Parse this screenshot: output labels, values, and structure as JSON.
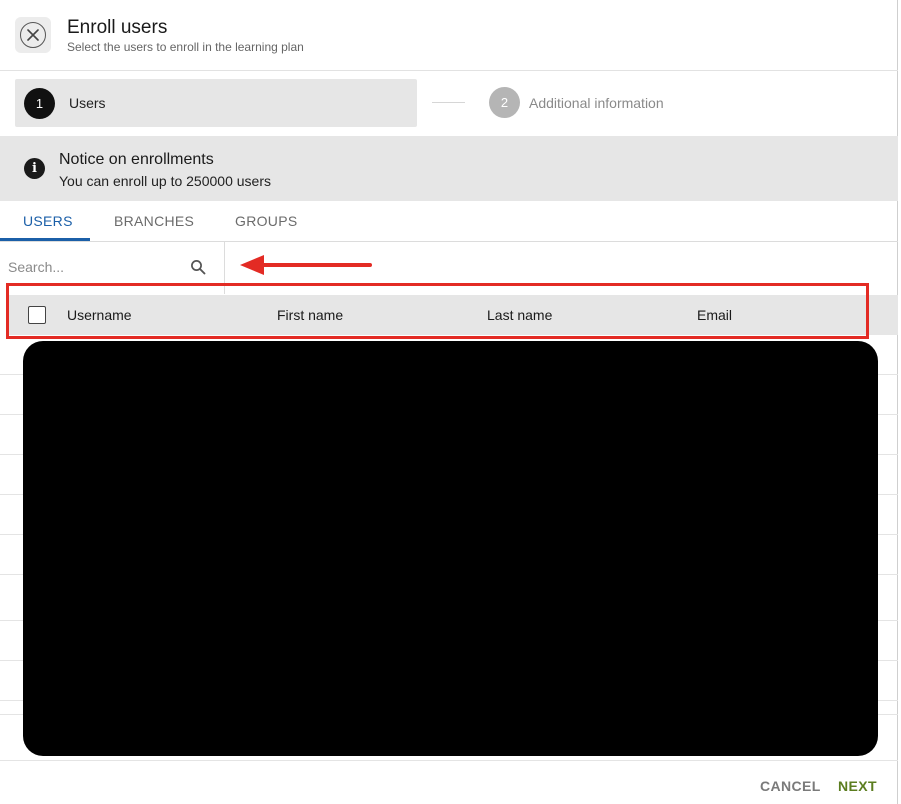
{
  "header": {
    "title": "Enroll users",
    "subtitle": "Select the users to enroll in the learning plan"
  },
  "stepper": {
    "steps": [
      {
        "number": "1",
        "label": "Users",
        "state": "active"
      },
      {
        "number": "2",
        "label": "Additional information",
        "state": "inactive"
      }
    ]
  },
  "notice": {
    "title": "Notice on enrollments",
    "text": "You can enroll up to 250000 users"
  },
  "tabs": [
    {
      "label": "USERS",
      "active": true
    },
    {
      "label": "BRANCHES",
      "active": false
    },
    {
      "label": "GROUPS",
      "active": false
    }
  ],
  "search": {
    "placeholder": "Search...",
    "value": ""
  },
  "table": {
    "columns": [
      "Username",
      "First name",
      "Last name",
      "Email"
    ],
    "select_all_checked": false
  },
  "footer": {
    "cancel_label": "CANCEL",
    "next_label": "NEXT"
  },
  "colors": {
    "accent": "#1b5fa8",
    "next": "#5b7d1f",
    "annotation": "#e32b24"
  },
  "icons": {
    "close": "close-icon",
    "info": "info-icon",
    "search": "search-icon"
  }
}
